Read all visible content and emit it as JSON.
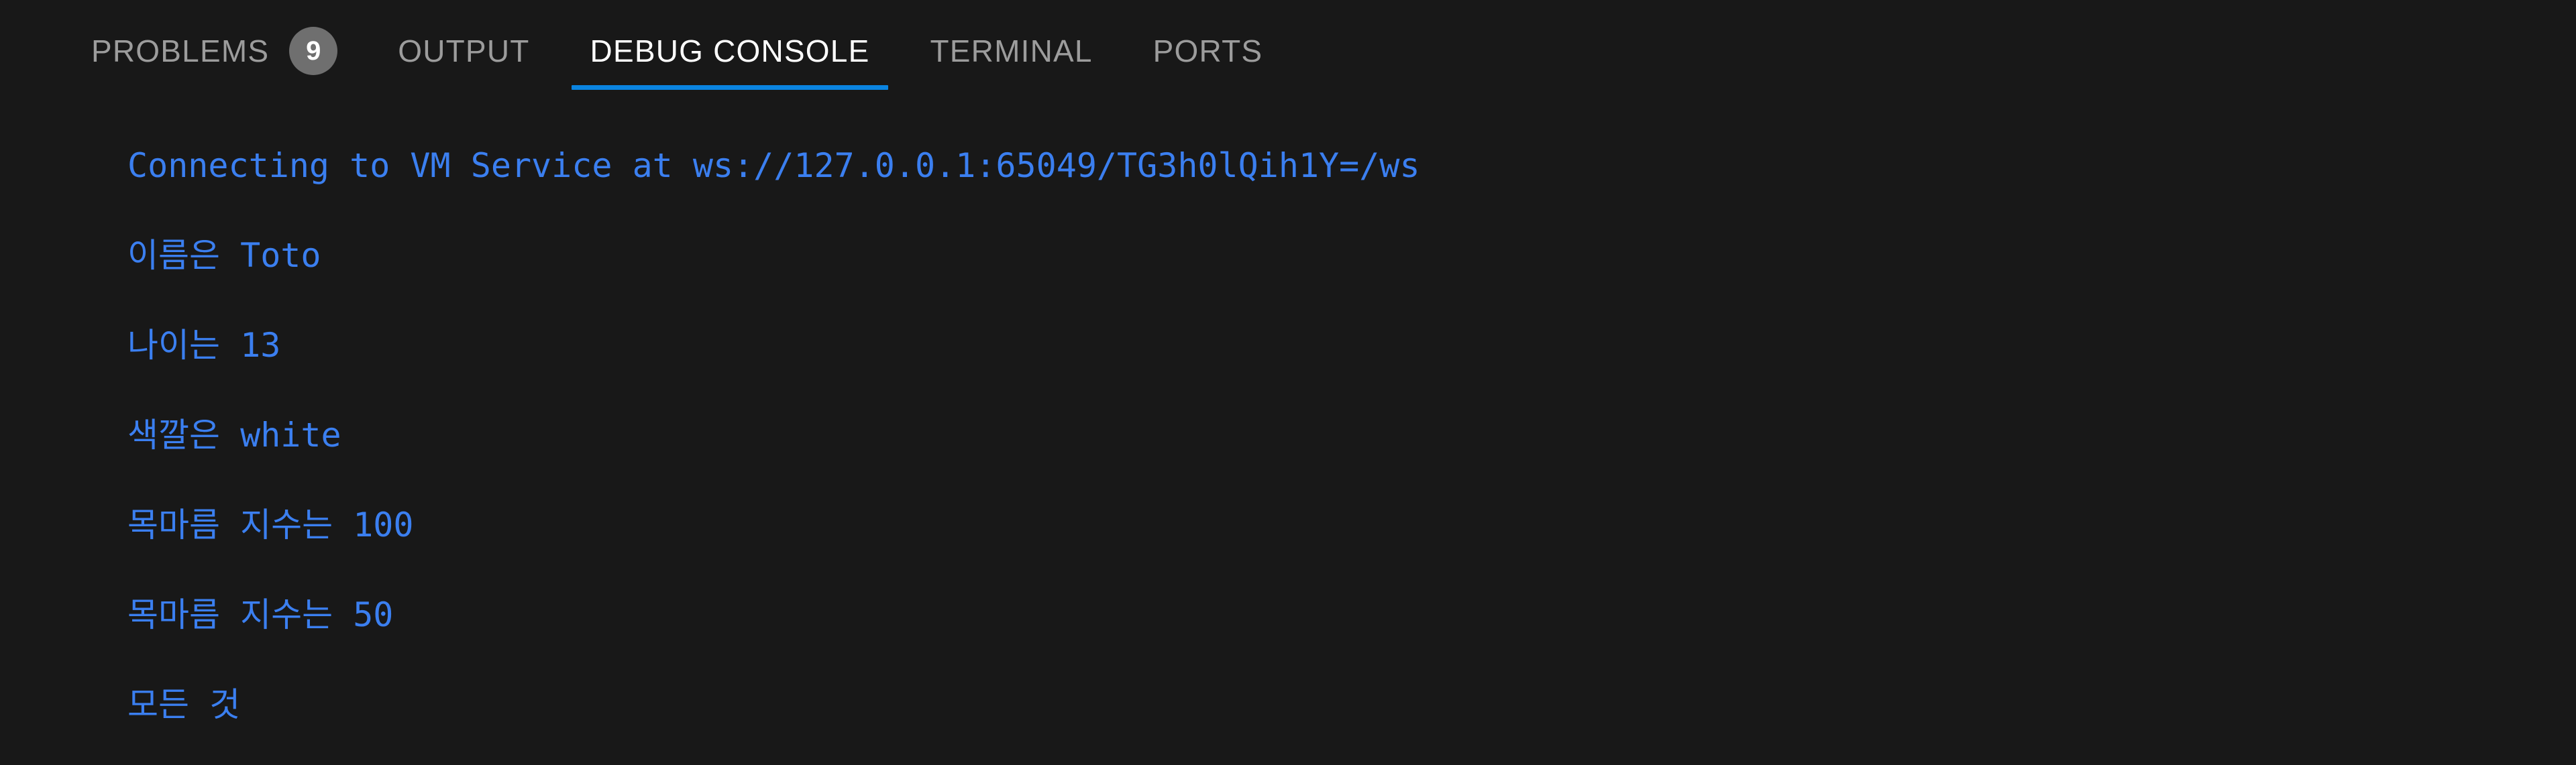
{
  "panel": {
    "background_color": "#181818",
    "active_tab_underline_color": "#0a84e0",
    "output_text_color": "#3b7ff0",
    "badge_background_color": "#6f6f6f",
    "tab_inactive_color": "#9c9c9c",
    "tab_active_color": "#ffffff"
  },
  "tabs": [
    {
      "id": "problems",
      "label": "PROBLEMS",
      "badge": "9",
      "active": false
    },
    {
      "id": "output",
      "label": "OUTPUT",
      "badge": null,
      "active": false
    },
    {
      "id": "debug-console",
      "label": "DEBUG CONSOLE",
      "badge": null,
      "active": true
    },
    {
      "id": "terminal",
      "label": "TERMINAL",
      "badge": null,
      "active": false
    },
    {
      "id": "ports",
      "label": "PORTS",
      "badge": null,
      "active": false
    }
  ],
  "console": {
    "lines": [
      {
        "text": "Connecting to VM Service at ws://127.0.0.1:65049/TG3h0lQih1Y=/ws"
      },
      {
        "text": "이름은 Toto"
      },
      {
        "text": "나이는 13"
      },
      {
        "text": "색깔은 white"
      },
      {
        "text": "목마름 지수는 100"
      },
      {
        "text": "목마름 지수는 50"
      },
      {
        "text": ""
      },
      {
        "text": "모든 것"
      }
    ]
  }
}
